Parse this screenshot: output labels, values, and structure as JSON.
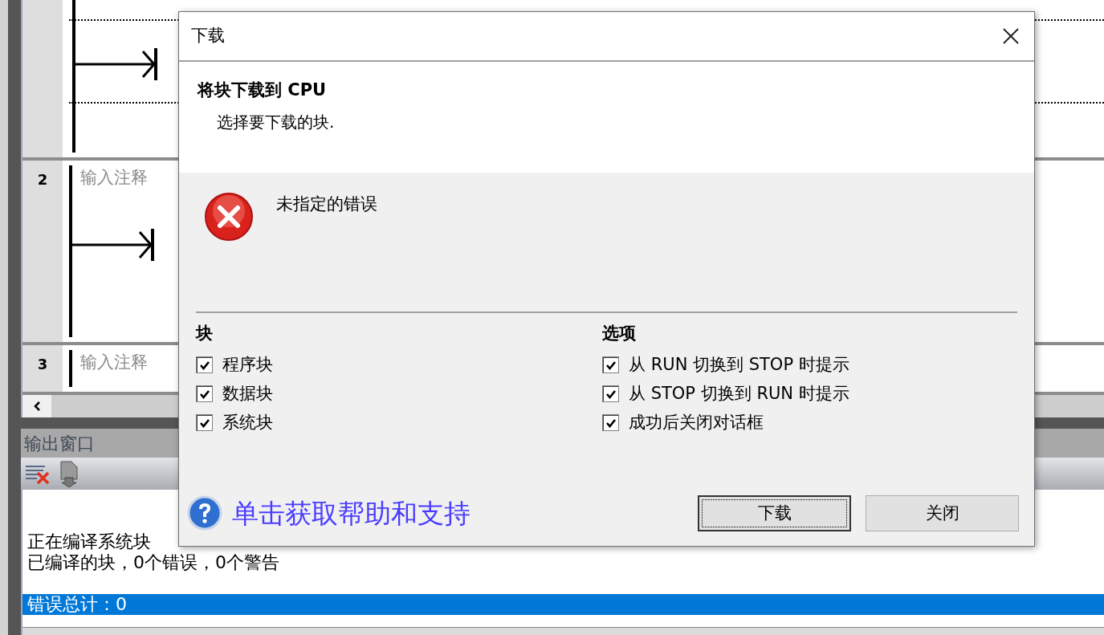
{
  "editor": {
    "networks": [
      {
        "number": "2",
        "comment": "输入注释"
      },
      {
        "number": "3",
        "comment": "输入注释"
      }
    ]
  },
  "output_window": {
    "title": "输出窗口",
    "lines": [
      "正在编译系统块",
      "已编译的块，0个错误，0个警告"
    ],
    "highlighted_line": "错误总计：0"
  },
  "dialog": {
    "title": "下载",
    "heading": "将块下载到 CPU",
    "subheading": "选择要下载的块.",
    "error_message": "未指定的错误",
    "blocks": {
      "title": "块",
      "items": [
        {
          "label": "程序块",
          "checked": true
        },
        {
          "label": "数据块",
          "checked": true
        },
        {
          "label": "系统块",
          "checked": true
        }
      ]
    },
    "options": {
      "title": "选项",
      "items": [
        {
          "label": "从 RUN 切换到 STOP 时提示",
          "checked": true
        },
        {
          "label": "从 STOP 切换到 RUN 时提示",
          "checked": true
        },
        {
          "label": "成功后关闭对话框",
          "checked": true
        }
      ]
    },
    "help_link": "单击获取帮助和支持",
    "buttons": [
      {
        "label": "下载",
        "focused": true
      },
      {
        "label": "关闭",
        "focused": false
      }
    ]
  }
}
